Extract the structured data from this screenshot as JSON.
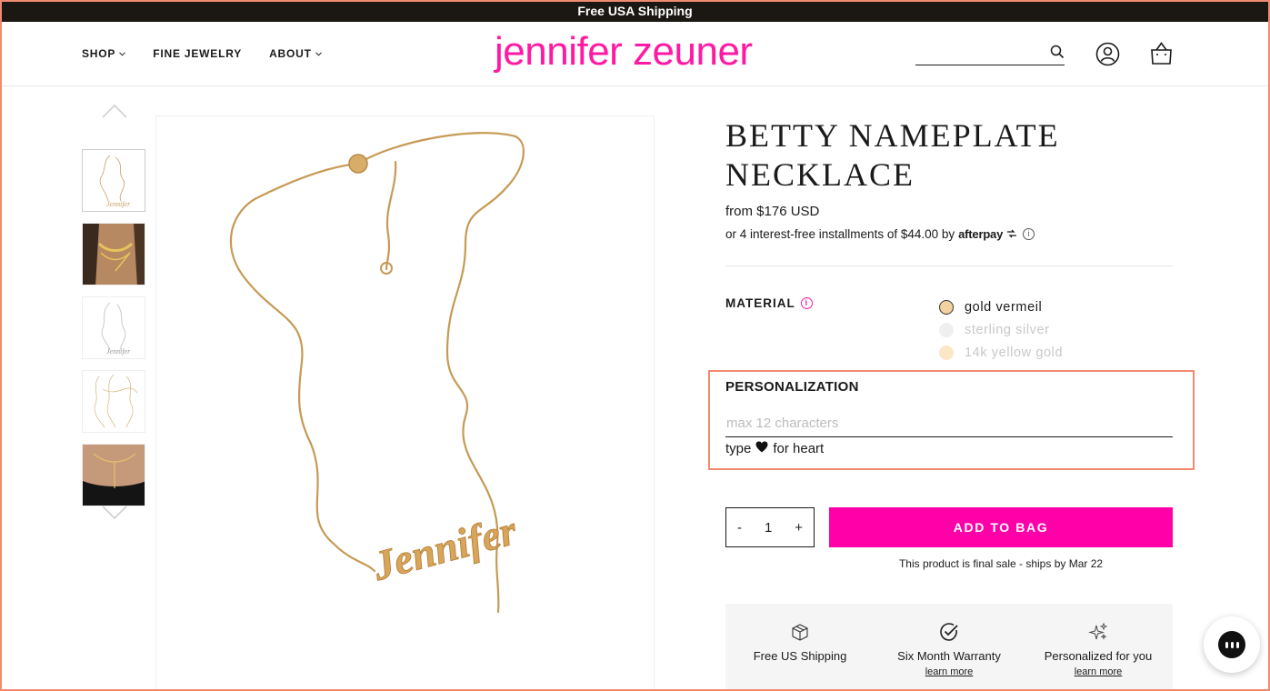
{
  "announcement": "Free USA Shipping",
  "header": {
    "nav": [
      {
        "label": "SHOP",
        "has_dropdown": true
      },
      {
        "label": "FINE JEWELRY",
        "has_dropdown": false
      },
      {
        "label": "ABOUT",
        "has_dropdown": true
      }
    ],
    "logo": "jennifer zeuner",
    "search": {
      "value": "",
      "placeholder": ""
    },
    "icons": [
      "search-icon",
      "account-icon",
      "bag-icon"
    ]
  },
  "gallery": {
    "thumbnails": [
      "nameplate-necklace-flat",
      "model-wearing-necklaces",
      "silver-nameplate-flat",
      "necklace-variants-flat",
      "model-lariat-closeup"
    ],
    "active_index": 0
  },
  "product": {
    "title_line1": "BETTY NAMEPLATE",
    "title_line2": "NECKLACE",
    "price": "from $176 USD",
    "installments_text": "or 4 interest-free installments of $44.00 by",
    "afterpay_label": "afterpay",
    "material": {
      "label": "MATERIAL",
      "options": [
        {
          "label": "gold vermeil",
          "selected": true,
          "available": true,
          "color": "#f2d2a0"
        },
        {
          "label": "sterling silver",
          "selected": false,
          "available": false,
          "color": "#efefef"
        },
        {
          "label": "14k yellow gold",
          "selected": false,
          "available": false,
          "color": "#fbe6c5"
        }
      ]
    },
    "personalization": {
      "label": "PERSONALIZATION",
      "placeholder": "max 12 characters",
      "value": "",
      "hint_prefix": "type",
      "hint_suffix": "for heart"
    },
    "quantity": {
      "minus": "-",
      "value": "1",
      "plus": "+"
    },
    "add_to_bag": "ADD TO BAG",
    "final_sale": "This product is final sale - ships by Mar 22",
    "perks": [
      {
        "icon": "box-icon",
        "title": "Free US Shipping",
        "link": ""
      },
      {
        "icon": "check-circle-icon",
        "title": "Six Month Warranty",
        "link": "learn more"
      },
      {
        "icon": "sparkle-icon",
        "title": "Personalized for you",
        "link": "learn more"
      }
    ]
  },
  "colors": {
    "brand_pink": "#ff1aa3",
    "button_pink": "#ff00a8",
    "announcement_bg": "#1b1712",
    "highlight": "#f08a70"
  }
}
